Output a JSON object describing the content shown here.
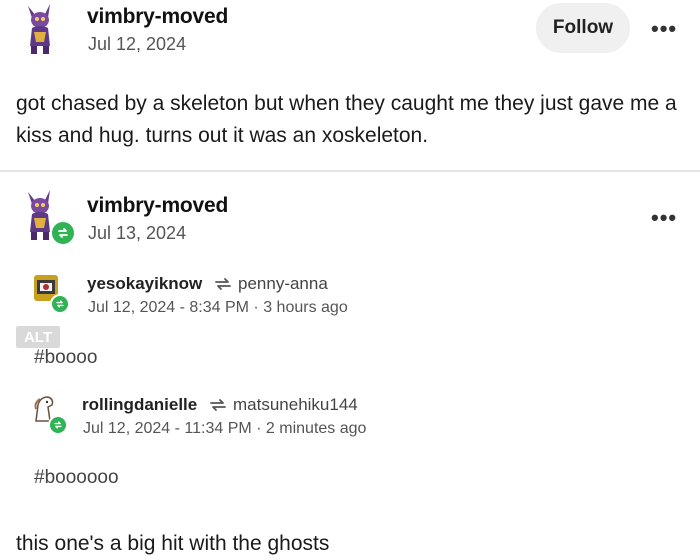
{
  "post": {
    "username": "vimbry-moved",
    "date": "Jul 12, 2024",
    "follow_label": "Follow",
    "more_label": "•••",
    "text": "got chased by a skeleton but when they caught me they just gave me a kiss and hug. turns out it was an xoskeleton."
  },
  "reblog_post": {
    "username": "vimbry-moved",
    "date": "Jul 13, 2024",
    "more_label": "•••",
    "alt_label": "ALT",
    "reblogs": [
      {
        "user": "yesokayiknow",
        "source": "penny-anna",
        "meta": "Jul 12, 2024 - 8:34 PM  ·  3 hours ago",
        "tag": "#boooo"
      },
      {
        "user": "rollingdanielle",
        "source": "matsunehiku144",
        "meta": "Jul 12, 2024 - 11:34 PM  ·  2 minutes ago",
        "tag": "#boooooo"
      }
    ],
    "comment": "this one's a big hit with the ghosts"
  },
  "colors": {
    "badge_green": "#2fb355",
    "follow_bg": "#f0f0f0"
  }
}
